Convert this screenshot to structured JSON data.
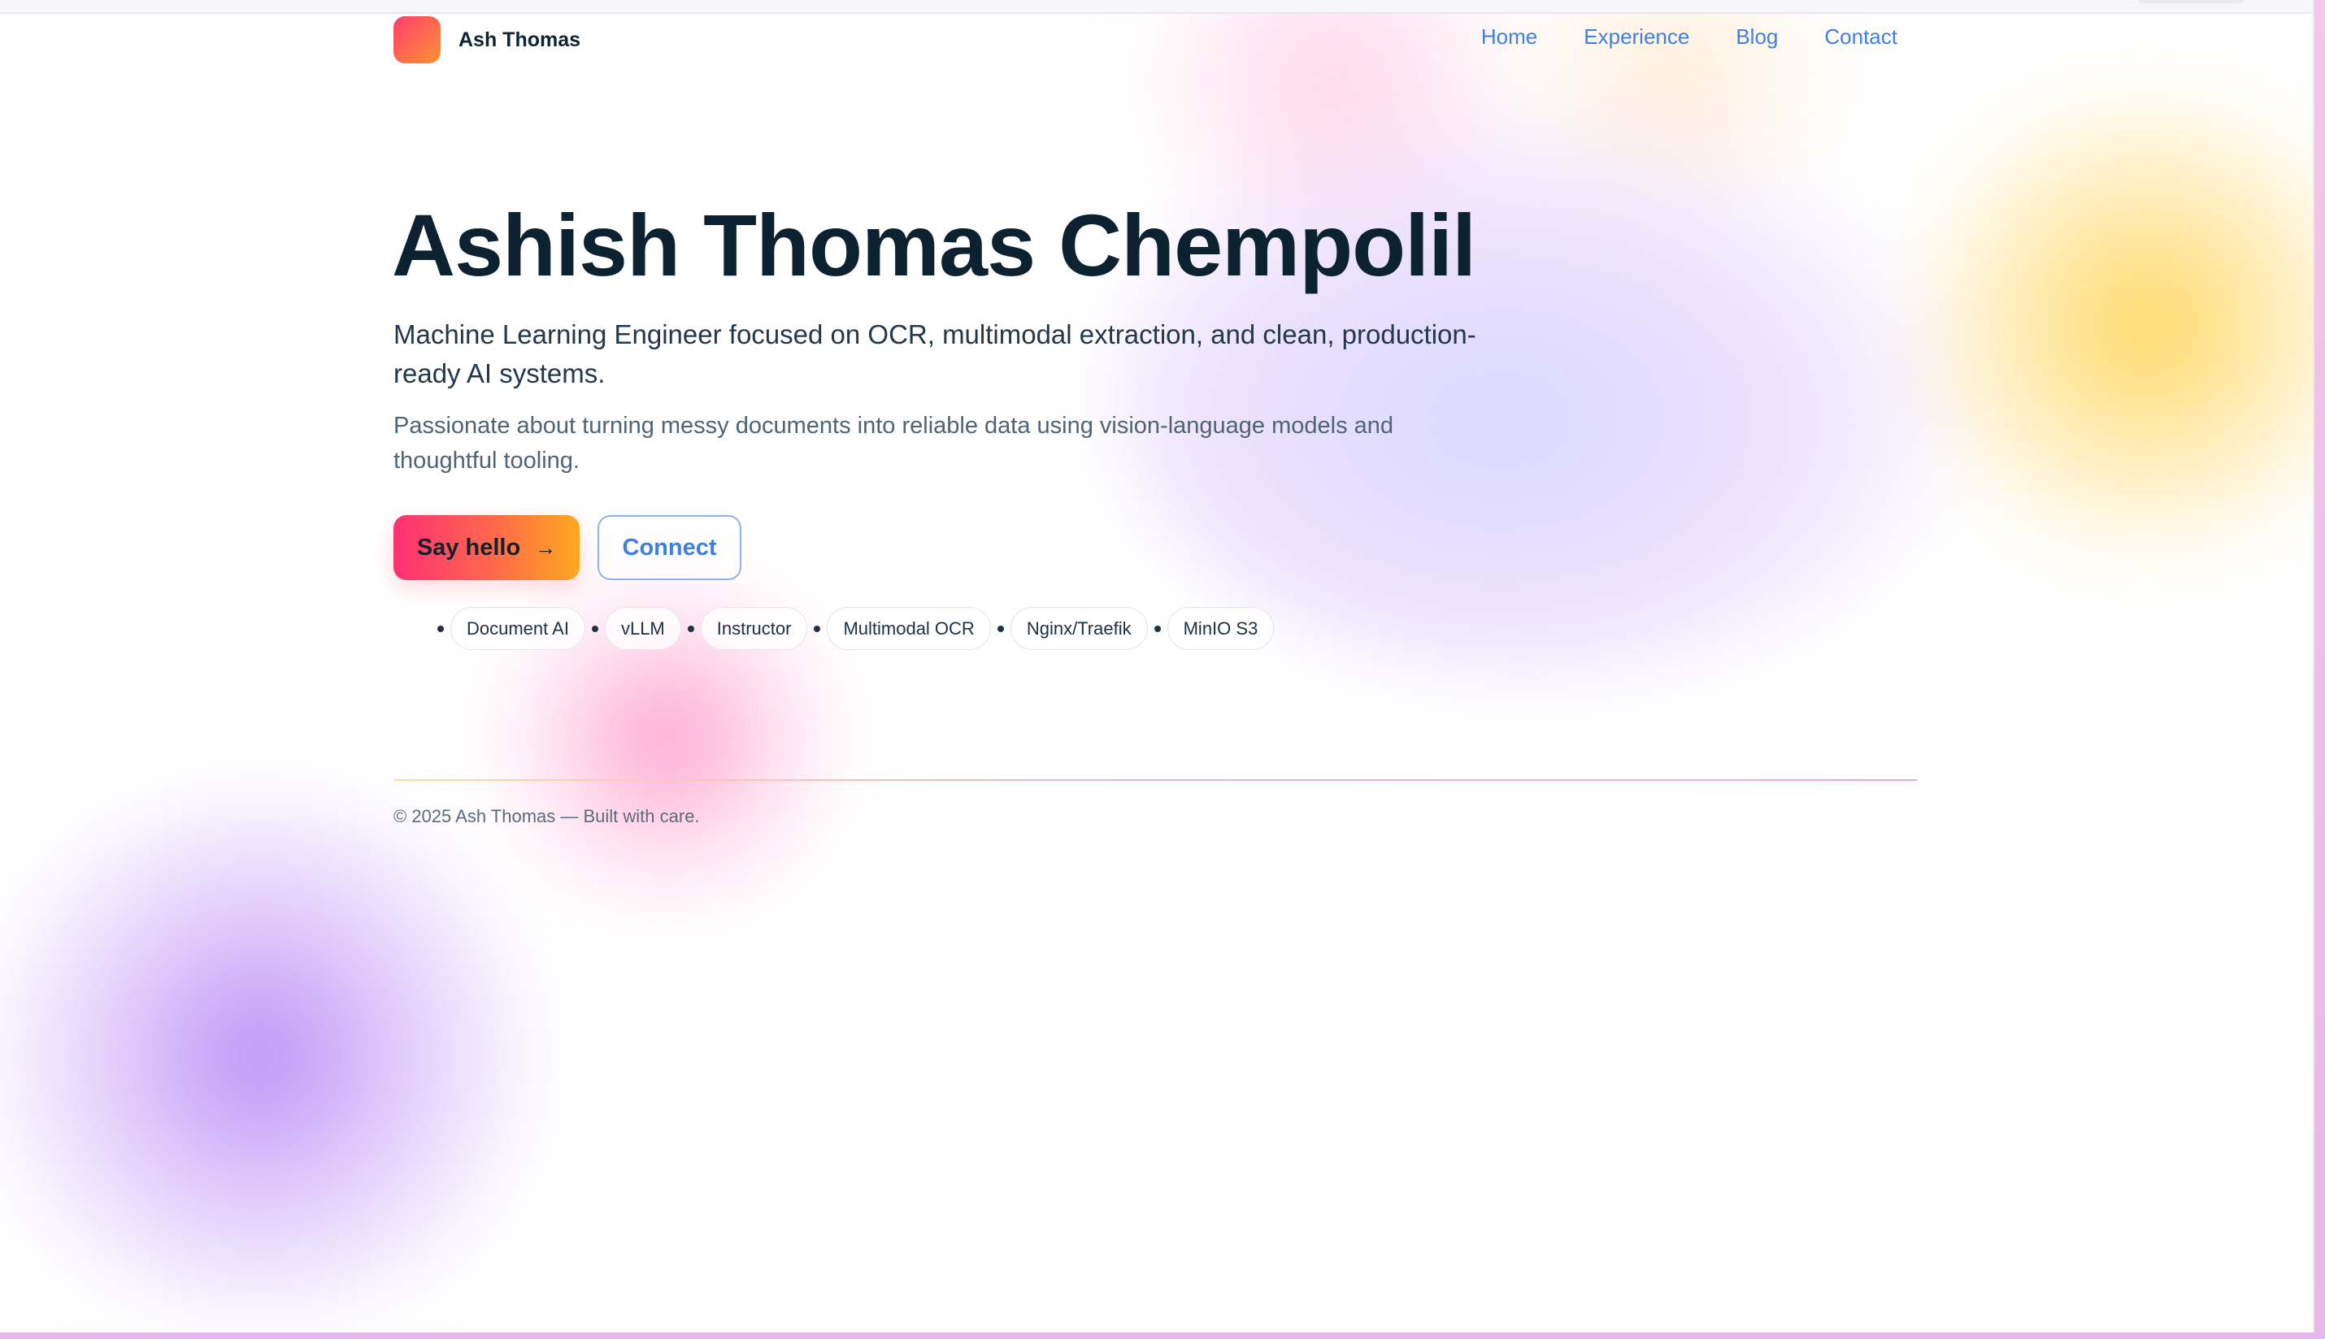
{
  "header": {
    "brand_name": "Ash Thomas",
    "nav": [
      "Home",
      "Experience",
      "Blog",
      "Contact"
    ]
  },
  "hero": {
    "title": "Ashish Thomas Chempolil",
    "subtitle": "Machine Learning Engineer focused on OCR, multimodal extraction, and clean, production-ready AI systems.",
    "description": "Passionate about turning messy documents into reliable data using vision-language models and thoughtful tooling.",
    "primary_button": "Say hello",
    "primary_button_icon": "→",
    "secondary_button": "Connect",
    "tags": [
      "Document AI",
      "vLLM",
      "Instructor",
      "Multimodal OCR",
      "Nginx/Traefik",
      "MinIO S3"
    ]
  },
  "footer": {
    "text": "© 2025 Ash Thomas — Built with care."
  },
  "colors": {
    "accent_link": "#3f7fe3",
    "heading": "#0d2231",
    "gradient_start": "#ff2f75",
    "gradient_end": "#ffa81f"
  }
}
